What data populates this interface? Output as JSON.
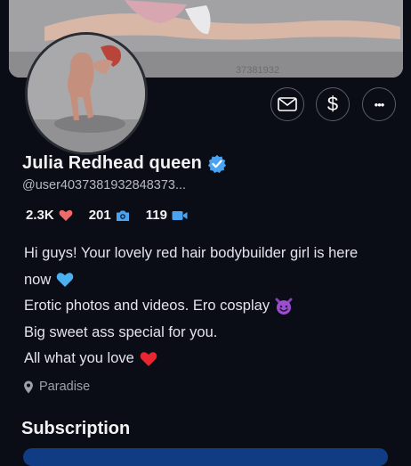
{
  "cover": {
    "watermark": "37381932"
  },
  "actions": [
    {
      "name": "message-button",
      "icon": "envelope-icon"
    },
    {
      "name": "tip-button",
      "icon": "dollar-icon",
      "glyph": "$"
    },
    {
      "name": "more-button",
      "icon": "more-dots-icon",
      "glyph": "•••"
    }
  ],
  "profile": {
    "name": "Julia Redhead queen",
    "verified": true,
    "handle": "@user4037381932848373..."
  },
  "stats": {
    "likes": "2.3K",
    "photos": "201",
    "videos": "119"
  },
  "bio": {
    "line1": "Hi guys! Your lovely red hair bodybuilder girl is here",
    "line2": "now",
    "line3": "Erotic photos and videos. Ero cosplay",
    "line4": "Big sweet ass special for you.",
    "line5": "All what you love"
  },
  "location": {
    "text": "Paradise"
  },
  "subscription": {
    "title": "Subscription"
  },
  "colors": {
    "accent": "#4aa3f0",
    "heart": "#f06a6a",
    "background": "#0b0d16",
    "button_blue": "#0f3c82"
  }
}
